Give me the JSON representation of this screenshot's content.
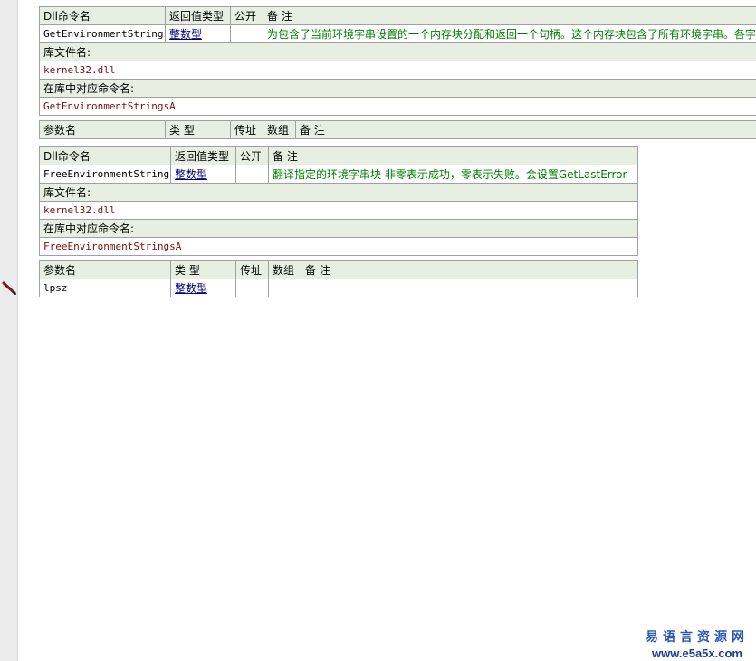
{
  "tables": [
    {
      "headers": {
        "name": "Dll命令名",
        "ret": "返回值类型",
        "pub": "公开",
        "remark": "备 注"
      },
      "command": {
        "name": "GetEnvironmentStrings",
        "ret": "整数型",
        "pub": "",
        "remark": "为包含了当前环境字串设置的一个内存块分配和返回一个句柄。这个内存块包含了所有环境字串。各字"
      },
      "lib_label": "库文件名:",
      "lib_value": "kernel32.dll",
      "alias_label": "在库中对应命令名:",
      "alias_value": "GetEnvironmentStringsA",
      "param_headers": {
        "name": "参数名",
        "type": "类 型",
        "byref": "传址",
        "array": "数组",
        "remark": "备 注"
      },
      "params": []
    },
    {
      "headers": {
        "name": "Dll命令名",
        "ret": "返回值类型",
        "pub": "公开",
        "remark": "备 注"
      },
      "command": {
        "name": "FreeEnvironmentStrings",
        "ret": "整数型",
        "pub": "",
        "remark": "翻译指定的环境字串块  非零表示成功，零表示失败。会设置GetLastError"
      },
      "lib_label": "库文件名:",
      "lib_value": "kernel32.dll",
      "alias_label": "在库中对应命令名:",
      "alias_value": "FreeEnvironmentStringsA",
      "param_headers": {
        "name": "参数名",
        "type": "类 型",
        "byref": "传址",
        "array": "数组",
        "remark": "备 注"
      },
      "params": [
        {
          "name": "lpsz",
          "type": "整数型",
          "byref": "",
          "array": "",
          "remark": ""
        }
      ]
    }
  ],
  "watermark": {
    "cn": "易语言资源网",
    "url": "www.e5a5x.com"
  },
  "icons": {
    "gutter_marker": "pencil-icon"
  },
  "colors": {
    "header_bg": "#e8eee2",
    "remark": "#008000",
    "type_link": "#000080",
    "value": "#7a1010"
  }
}
